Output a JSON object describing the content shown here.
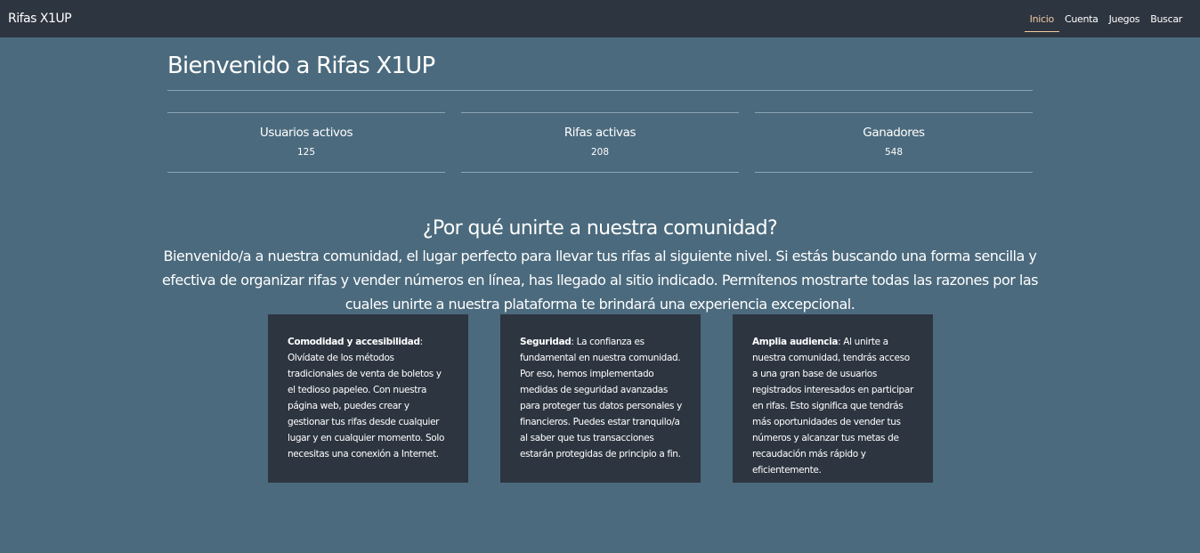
{
  "nav": {
    "brand": "Rifas X1UP",
    "links": [
      {
        "label": "Inicio",
        "active": true
      },
      {
        "label": "Cuenta",
        "active": false
      },
      {
        "label": "Juegos",
        "active": false
      },
      {
        "label": "Buscar",
        "active": false
      }
    ]
  },
  "main": {
    "title": "Bienvenido a Rifas X1UP",
    "stats": [
      {
        "label": "Usuarios activos",
        "value": "125"
      },
      {
        "label": "Rifas activas",
        "value": "208"
      },
      {
        "label": "Ganadores",
        "value": "548"
      }
    ],
    "why_title": "¿Por qué unirte a nuestra comunidad?",
    "why_text": "Bienvenido/a a nuestra comunidad, el lugar perfecto para llevar tus rifas al siguiente nivel. Si estás buscando una forma sencilla y efectiva de organizar rifas y vender números en línea, has llegado al sitio indicado. Permítenos mostrarte todas las razones por las cuales unirte a nuestra plataforma te brindará una experiencia excepcional.",
    "cards": [
      {
        "heading": "Comodidad y accesibilidad",
        "text": ": Olvídate de los métodos tradicionales de venta de boletos y el tedioso papeleo. Con nuestra página web, puedes crear y gestionar tus rifas desde cualquier lugar y en cualquier momento. Solo necesitas una conexión a Internet."
      },
      {
        "heading": "Seguridad",
        "text": ": La confianza es fundamental en nuestra comunidad. Por eso, hemos implementado medidas de seguridad avanzadas para proteger tus datos personales y financieros. Puedes estar tranquilo/a al saber que tus transacciones estarán protegidas de principio a fin."
      },
      {
        "heading": "Amplia audiencia",
        "text": ": Al unirte a nuestra comunidad, tendrás acceso a una gran base de usuarios registrados interesados en participar en rifas. Esto significa que tendrás más oportunidades de vender tus números y alcanzar tus metas de recaudación más rápido y eficientemente."
      }
    ]
  }
}
